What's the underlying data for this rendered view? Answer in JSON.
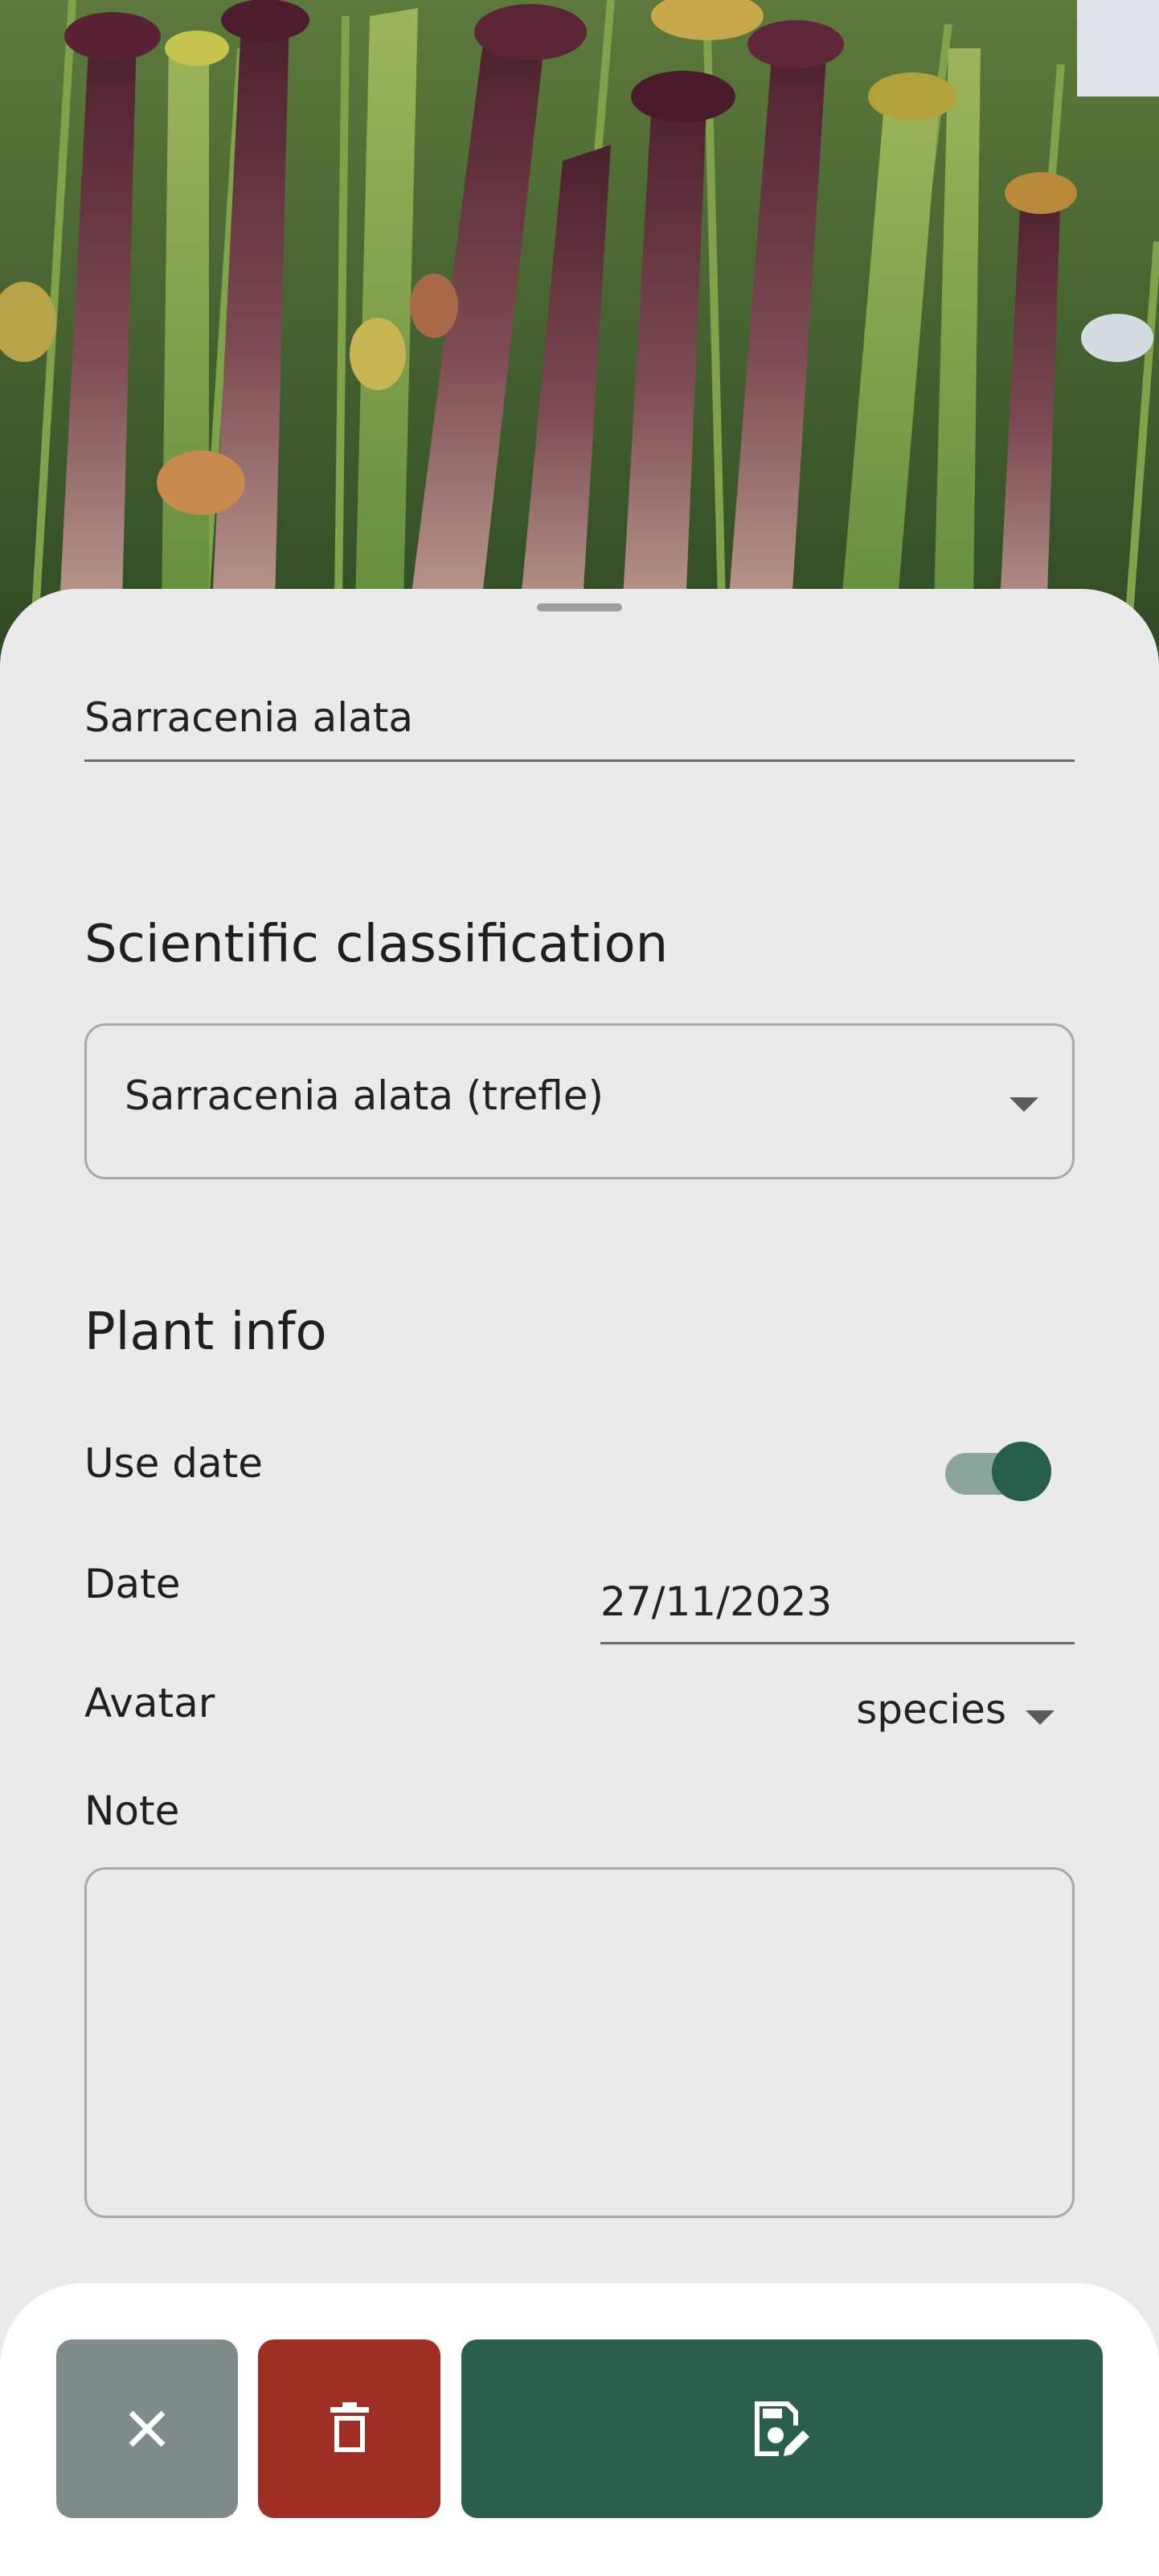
{
  "plant": {
    "name": "Sarracenia alata"
  },
  "classification": {
    "title": "Scientific classification",
    "selected": "Sarracenia alata (trefle)"
  },
  "plant_info": {
    "title": "Plant info",
    "use_date_label": "Use date",
    "use_date_enabled": true,
    "date_label": "Date",
    "date_value": "27/11/2023",
    "avatar_label": "Avatar",
    "avatar_value": "species",
    "note_label": "Note",
    "note_value": ""
  },
  "actions": {
    "cancel_icon": "close-icon",
    "delete_icon": "trash-icon",
    "save_icon": "save-edit-icon"
  },
  "colors": {
    "accent": "#2a5f4b",
    "toggle_thumb": "#265f4b",
    "toggle_track": "#8aa699",
    "delete": "#9f2e25",
    "cancel": "#7f8b8b",
    "sheet_background": "#eaeaea"
  }
}
